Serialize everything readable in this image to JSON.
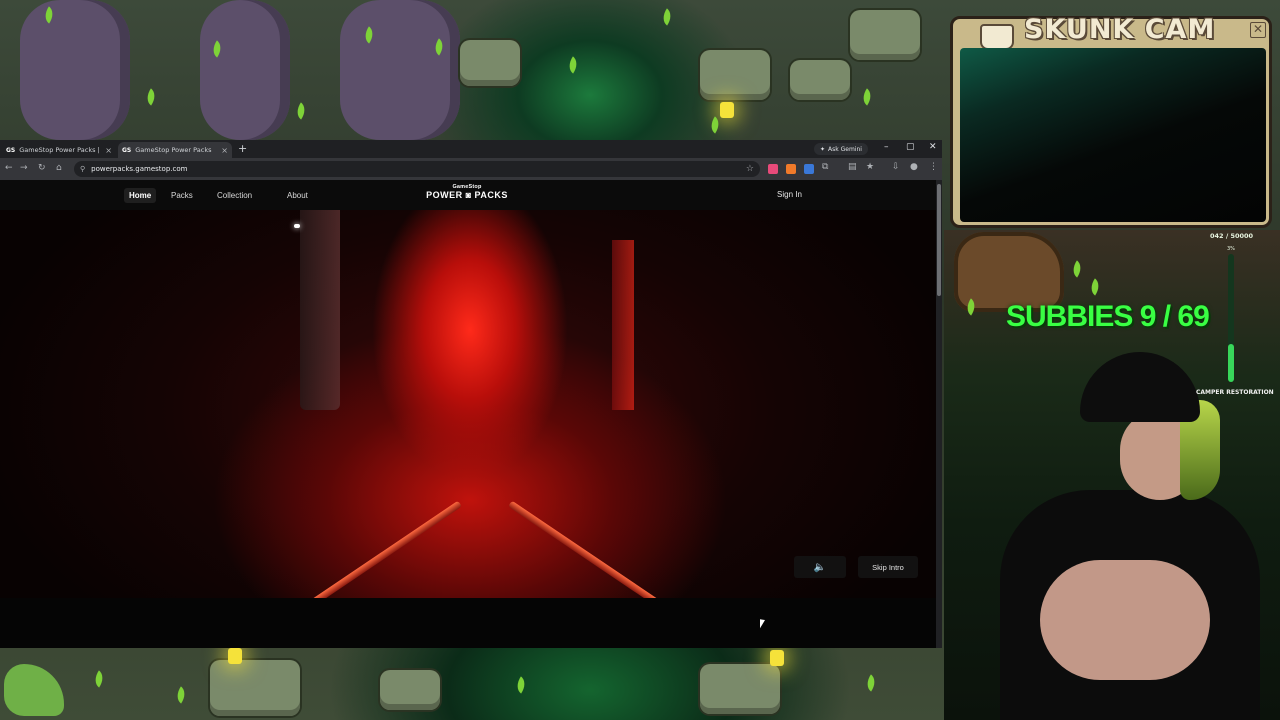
{
  "browser": {
    "tabs": [
      {
        "favicon": "GS",
        "title": "GameStop Power Packs | Game",
        "close": "×"
      },
      {
        "favicon": "GS",
        "title": "GameStop Power Packs",
        "close": "×"
      }
    ],
    "new_tab": "+",
    "ask_gemini": "Ask Gemini",
    "url": "powerpacks.gamestop.com",
    "window_controls": {
      "minimize": "–",
      "maximize": "▢",
      "close": "✕"
    }
  },
  "site": {
    "nav": [
      "Home",
      "Packs",
      "Collection",
      "About"
    ],
    "active_nav": "Home",
    "logo_top": "GameStop",
    "logo_bottom": "POWER ◙ PACKS",
    "sign_in": "Sign In",
    "mute_icon": "🔈",
    "skip_intro": "Skip Intro"
  },
  "overlay": {
    "cam_title": "SKUNK CAM",
    "cam_close": "✕",
    "sub_counter": "042 / 50000",
    "sub_percent": "3%",
    "goal_fraction": 0.3,
    "goal_label": "CAMPER RESTORATION",
    "subbies": "SUBBIES 9 / 69"
  },
  "colors": {
    "accent_green": "#39ff43",
    "page_bg": "#000000",
    "video_red": "#ff2a1a"
  }
}
